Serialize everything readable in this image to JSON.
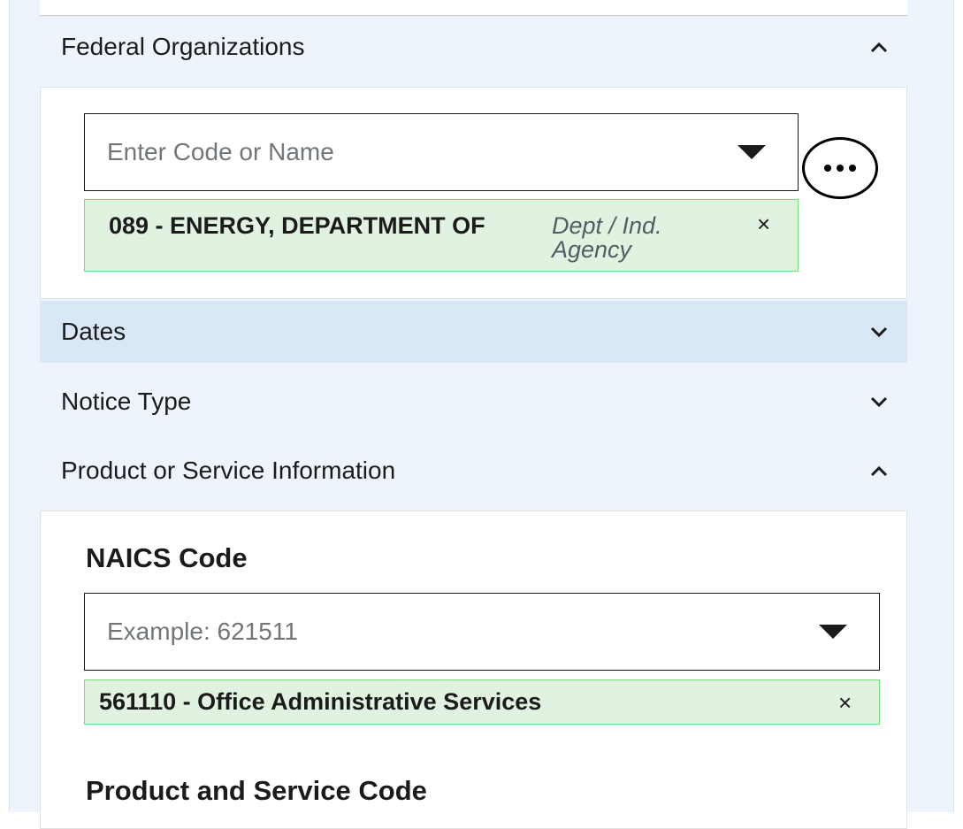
{
  "filters": {
    "federal_orgs": {
      "title": "Federal Organizations",
      "input_placeholder": "Enter Code or Name",
      "selected": {
        "label": "089 - ENERGY, DEPARTMENT OF",
        "type": "Dept / Ind. Agency",
        "remove": "×"
      },
      "more_label": "..."
    },
    "dates": {
      "title": "Dates"
    },
    "notice_type": {
      "title": "Notice Type"
    },
    "product_service": {
      "title": "Product or Service Information",
      "naics": {
        "title": "NAICS Code",
        "input_placeholder": "Example: 621511",
        "selected": {
          "label": "561110 - Office Administrative Services",
          "remove": "×"
        }
      },
      "psc": {
        "title": "Product and Service Code"
      }
    }
  },
  "icons": {
    "collapse": "chevron-up-icon",
    "expand": "chevron-down-icon",
    "dropdown": "caret-down-icon",
    "more": "more-horizontal-icon",
    "remove": "close-icon"
  },
  "colors": {
    "panel_bg": "#eef4fb",
    "active_header_bg": "#d9e8f6",
    "chip_bg": "#e1f3e0",
    "chip_border": "#70e17b"
  }
}
